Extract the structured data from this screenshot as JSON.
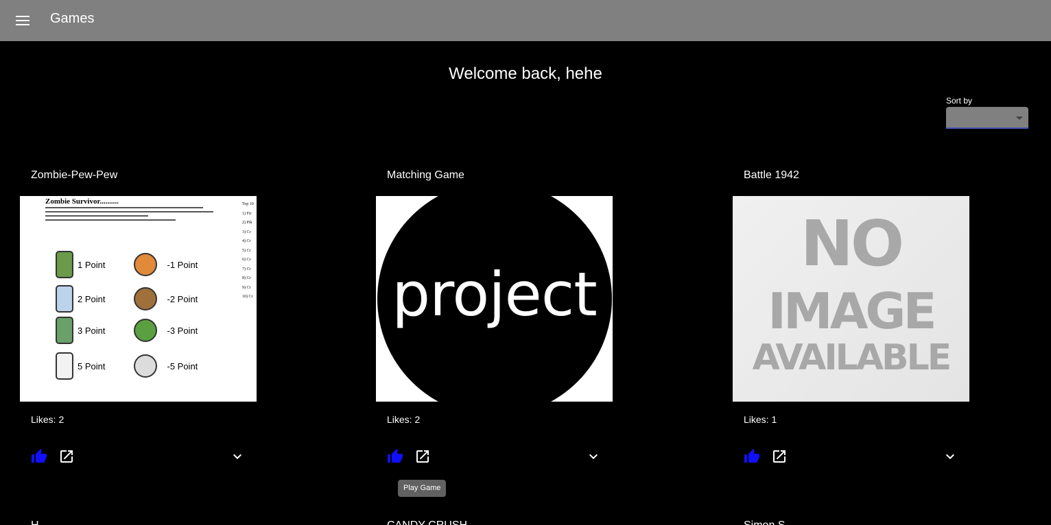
{
  "appbar": {
    "title": "Games",
    "menu_icon": "menu-icon"
  },
  "welcome": "Welcome back, hehe",
  "sort": {
    "label": "Sort by",
    "value": ""
  },
  "cards": [
    {
      "title": "Zombie-Pew-Pew",
      "likes": "Likes: 2"
    },
    {
      "title": "Matching Game",
      "likes": "Likes: 2"
    },
    {
      "title": "Battle 1942",
      "likes": "Likes: 1"
    }
  ],
  "zombie_image": {
    "heading": "Zombie Survivor..........",
    "top_list": [
      "Top 10",
      "1) Fir",
      "2) Pik",
      "3) Cr",
      "4) Cr",
      "5) Cr",
      "6) Cr",
      "7) Cr",
      "8) Cr",
      "9) Cr",
      "10) Cr"
    ],
    "rows": [
      {
        "left": "1 Point",
        "right": "-1 Point",
        "left_color": "#6a9a4a",
        "right_color": "#e08a3a"
      },
      {
        "left": "2 Point",
        "right": "-2 Point",
        "left_color": "#bcd3ec",
        "right_color": "#a0703a"
      },
      {
        "left": "3 Point",
        "right": "-3 Point",
        "left_color": "#6aa06a",
        "right_color": "#5aa040"
      },
      {
        "left": "5 Point",
        "right": "-5 Point",
        "left_color": "#f2f2f2",
        "right_color": "#dcdcdc"
      }
    ]
  },
  "project_image": {
    "text": "project"
  },
  "no_image": {
    "lines": [
      "NO",
      "IMAGE",
      "AVAILABLE"
    ]
  },
  "tooltip": "Play Game",
  "next_row": [
    "H...",
    "CANDY CRUSH",
    "Simon S..."
  ],
  "colors": {
    "appbar": "#808080",
    "like": "#1010ff",
    "background": "#000000"
  }
}
